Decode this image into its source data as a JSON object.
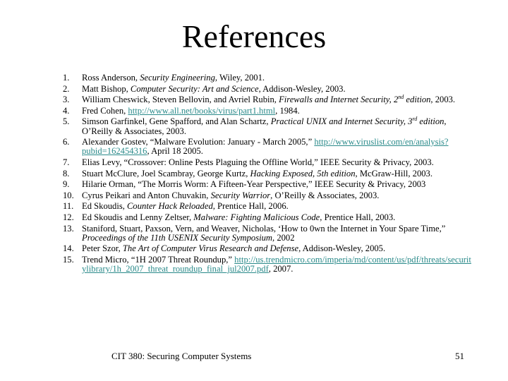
{
  "slide": {
    "title": "References",
    "footer": "CIT 380: Securing Computer Systems",
    "page_number": "51",
    "link_color": "#2a8a8a"
  },
  "references": [
    {
      "num": "1.",
      "a": "Ross Anderson, ",
      "title": "Security Engineering",
      "b": ", Wiley, 2001."
    },
    {
      "num": "2.",
      "a": "Matt Bishop, ",
      "title": "Computer Security: Art and Science",
      "b": ", Addison-Wesley, 2003."
    },
    {
      "num": "3.",
      "a": "William Cheswick, Steven Bellovin, and Avriel Rubin, ",
      "title": "Firewalls and Internet Security, 2",
      "sup": "nd",
      "title2": " edition",
      "b": ", 2003."
    },
    {
      "num": "4.",
      "a": "Fred Cohen, ",
      "link": "http://www.all.net/books/virus/part1.html",
      "b": ", 1984."
    },
    {
      "num": "5.",
      "a": "Simson Garfinkel, Gene Spafford, and Alan Schartz, ",
      "title": "Practical UNIX and Internet Security, 3",
      "sup": "rd",
      "title2": " edition",
      "b": ", O’Reilly & Associates, 2003."
    },
    {
      "num": "6.",
      "a": "Alexander Gostev, “Malware Evolution: January - March 2005,” ",
      "link": "http://www.viruslist.com/en/analysis?pubid=162454316",
      "b": ", April 18 2005."
    },
    {
      "num": "7.",
      "a": "Elias Levy, “Crossover: Online Pests Plaguing the Offline World,” IEEE Security & Privacy, 2003."
    },
    {
      "num": "8.",
      "a": "Stuart McClure, Joel Scambray, George Kurtz, ",
      "title": "Hacking Exposed, 5th edition",
      "b": ", McGraw-Hill, 2003."
    },
    {
      "num": "9.",
      "a": "Hilarie Orman, “The Morris Worm: A Fifteen-Year Perspective,” IEEE  Security & Privacy, 2003"
    },
    {
      "num": "10.",
      "a": "Cyrus Peikari and Anton Chuvakin, ",
      "title": "Security Warrior",
      "b": ", O’Reilly & Associates, 2003."
    },
    {
      "num": "11.",
      "a": "Ed Skoudis, ",
      "title": "Counter Hack Reloaded",
      "b": ", Prentice Hall, 2006."
    },
    {
      "num": "12.",
      "a": "Ed Skoudis and Lenny Zeltser, ",
      "title": "Malware: Fighting Malicious Code",
      "b": ", Prentice Hall, 2003."
    },
    {
      "num": "13.",
      "a": "Staniford, Stuart, Paxson, Vern, and Weaver, Nicholas, ‘How to 0wn the Internet in Your Spare Time,” ",
      "title": "Proceedings of the 11th USENIX Security Symposium",
      "b": ", 2002"
    },
    {
      "num": "14.",
      "a": "Peter Szor, ",
      "title": "The Art of Computer Virus Research and Defense",
      "b": ", Addison-Wesley, 2005."
    },
    {
      "num": "15.",
      "a": "Trend Micro, “1H 2007 Threat Roundup,” ",
      "link": "http://us.trendmicro.com/imperia/md/content/us/pdf/threats/securitylibrary/1h_2007_threat_roundup_final_jul2007.pdf",
      "b": ", 2007."
    }
  ]
}
